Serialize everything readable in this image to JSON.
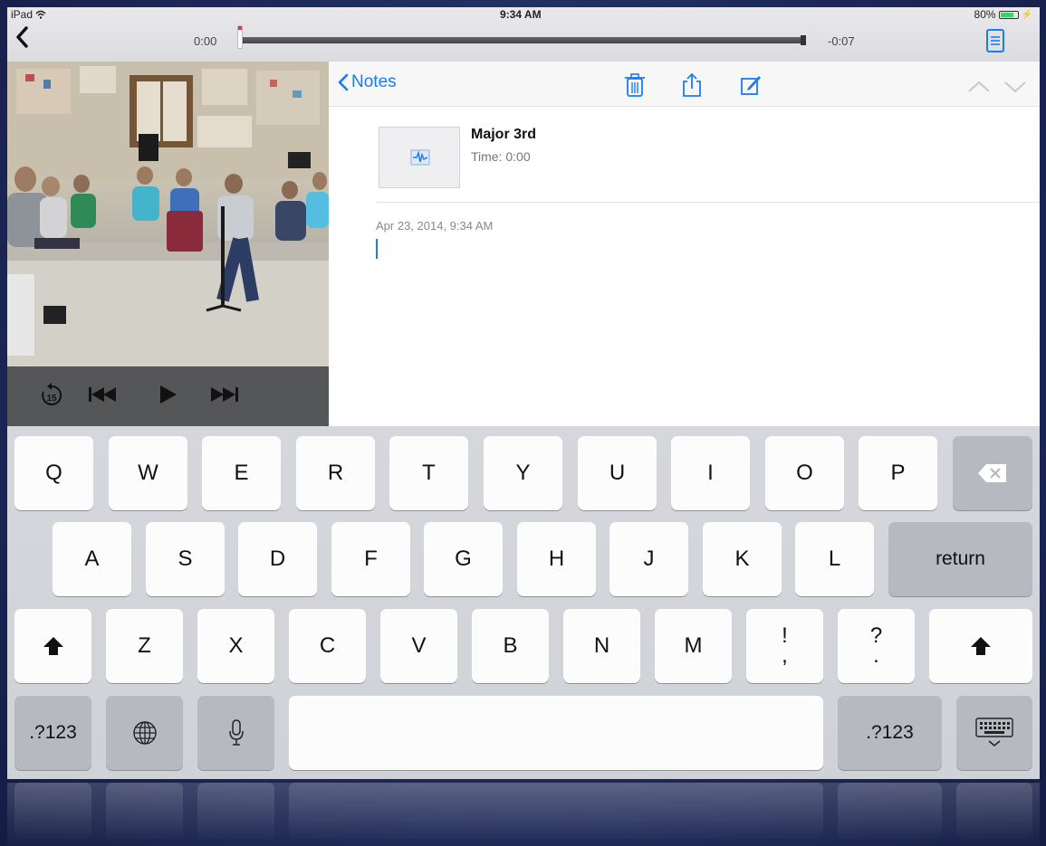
{
  "status_bar": {
    "carrier": "iPad",
    "time": "9:34 AM",
    "battery": "80%",
    "battery_level": 0.8
  },
  "player": {
    "elapsed": "0:00",
    "remaining": "-0:07",
    "progress": 0
  },
  "notes": {
    "back_label": "Notes",
    "attachment": {
      "title": "Major 3rd",
      "time": "Time: 0:00"
    },
    "date": "Apr 23, 2014, 9:34 AM",
    "body": ""
  },
  "keyboard": {
    "row1": [
      "Q",
      "W",
      "E",
      "R",
      "T",
      "Y",
      "U",
      "I",
      "O",
      "P"
    ],
    "row2": [
      "A",
      "S",
      "D",
      "F",
      "G",
      "H",
      "J",
      "K",
      "L"
    ],
    "row3": [
      "Z",
      "X",
      "C",
      "V",
      "B",
      "N",
      "M"
    ],
    "punct1": {
      "top": "!",
      "bottom": ","
    },
    "punct2": {
      "top": "?",
      "bottom": "."
    },
    "return_label": "return",
    "numbers_label": ".?123"
  },
  "colors": {
    "ios_blue": "#1a7cf5",
    "video_controls_bg": "#555658",
    "scrub_marker": "#e33333"
  },
  "icons": {
    "back": "chevron-left-icon",
    "notes_doc": "document-icon",
    "trash": "trash-icon",
    "share": "share-icon",
    "compose": "compose-icon",
    "prev_note": "chevron-up-icon",
    "next_note": "chevron-down-icon",
    "skip_back_15": "replay-15-icon",
    "prev_track": "previous-track-icon",
    "play": "play-icon",
    "next_track": "next-track-icon",
    "delete": "backspace-icon",
    "shift": "shift-icon",
    "globe": "globe-icon",
    "mic": "microphone-icon",
    "hide_keyboard": "keyboard-dismiss-icon"
  }
}
